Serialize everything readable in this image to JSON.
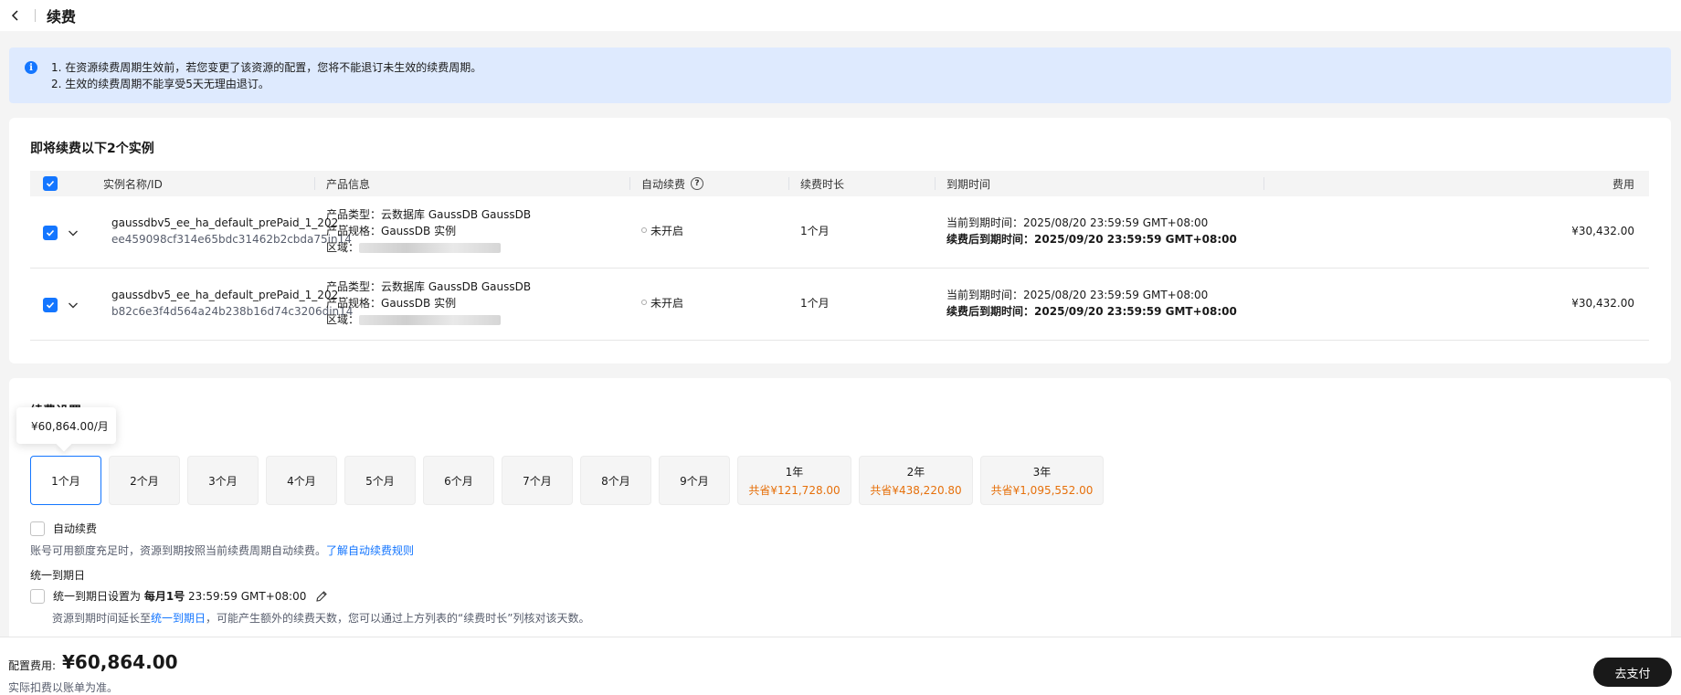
{
  "page": {
    "title": "续费"
  },
  "notice": {
    "lines": [
      "1. 在资源续费周期生效前，若您变更了该资源的配置，您将不能退订未生效的续费周期。",
      "2. 生效的续费周期不能享受5天无理由退订。"
    ]
  },
  "instances": {
    "title": "即将续费以下2个实例",
    "columns": {
      "name": "实例名称/ID",
      "product": "产品信息",
      "auto_renew": "自动续费",
      "duration": "续费时长",
      "expiry": "到期时间",
      "fee": "费用"
    },
    "rows": [
      {
        "name": "gaussdbv5_ee_ha_default_prePaid_1_202...",
        "id": "ee459098cf314e65bdc31462b2cbda75in14",
        "type_label": "产品类型：",
        "type": "云数据库 GaussDB GaussDB",
        "spec_label": "产品规格：",
        "spec": "GaussDB 实例",
        "region_label": "区域：",
        "auto_renew": "未开启",
        "duration": "1个月",
        "current_expiry": "当前到期时间：2025/08/20 23:59:59 GMT+08:00",
        "new_expiry_label": "续费后到期时间：",
        "new_expiry": "2025/09/20 23:59:59 GMT+08:00",
        "fee": "¥30,432.00"
      },
      {
        "name": "gaussdbv5_ee_ha_default_prePaid_1_202...",
        "id": "b82c6e3f4d564a24b238b16d74c3206din14",
        "type_label": "产品类型：",
        "type": "云数据库 GaussDB GaussDB",
        "spec_label": "产品规格：",
        "spec": "GaussDB 实例",
        "region_label": "区域：",
        "auto_renew": "未开启",
        "duration": "1个月",
        "current_expiry": "当前到期时间：2025/08/20 23:59:59 GMT+08:00",
        "new_expiry_label": "续费后到期时间：",
        "new_expiry": "2025/09/20 23:59:59 GMT+08:00",
        "fee": "¥30,432.00"
      }
    ]
  },
  "period": {
    "title": "续费设置",
    "tooltip": "¥60,864.00/月",
    "options": [
      {
        "label": "1个月",
        "save": ""
      },
      {
        "label": "2个月",
        "save": ""
      },
      {
        "label": "3个月",
        "save": ""
      },
      {
        "label": "4个月",
        "save": ""
      },
      {
        "label": "5个月",
        "save": ""
      },
      {
        "label": "6个月",
        "save": ""
      },
      {
        "label": "7个月",
        "save": ""
      },
      {
        "label": "8个月",
        "save": ""
      },
      {
        "label": "9个月",
        "save": ""
      },
      {
        "label": "1年",
        "save": "共省¥121,728.00"
      },
      {
        "label": "2年",
        "save": "共省¥438,220.80"
      },
      {
        "label": "3年",
        "save": "共省¥1,095,552.00"
      }
    ],
    "selected_index": 0,
    "auto_renew_label": "自动续费",
    "auto_renew_desc": "账号可用额度充足时，资源到期按照当前续费周期自动续费。",
    "auto_renew_link": "了解自动续费规则",
    "unify_title": "统一到期日",
    "unify_label_prefix": "统一到期日设置为",
    "unify_day": "每月1号",
    "unify_time": "23:59:59 GMT+08:00",
    "unify_desc_prefix": "资源到期时间延长至",
    "unify_desc_link": "统一到期日",
    "unify_desc_suffix": "，可能产生额外的续费天数，您可以通过上方列表的“续费时长”列核对该天数。"
  },
  "footer": {
    "fee_label": "配置费用:",
    "fee_value": "¥60,864.00",
    "note": "实际扣费以账单为准。",
    "pay_button": "去支付"
  },
  "colors": {
    "accent": "#1476ff",
    "saving": "#e6700b",
    "pay_button": "#191919"
  }
}
